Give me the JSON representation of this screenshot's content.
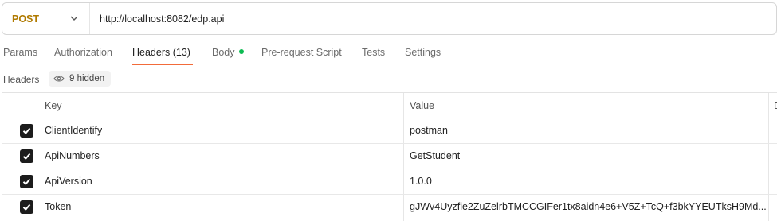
{
  "request": {
    "method": "POST",
    "url": "http://localhost:8082/edp.api"
  },
  "tabs": [
    {
      "label": "Params"
    },
    {
      "label": "Authorization"
    },
    {
      "label": "Headers (13)"
    },
    {
      "label": "Body"
    },
    {
      "label": "Pre-request Script"
    },
    {
      "label": "Tests"
    },
    {
      "label": "Settings"
    }
  ],
  "active_tab": "Headers (13)",
  "headers_section": {
    "label": "Headers",
    "hidden_text": "9 hidden"
  },
  "table": {
    "columns": [
      "Key",
      "Value",
      "D"
    ],
    "rows": [
      {
        "key": "ClientIdentify",
        "value": "postman",
        "checked": true
      },
      {
        "key": "ApiNumbers",
        "value": "GetStudent",
        "checked": true
      },
      {
        "key": "ApiVersion",
        "value": "1.0.0",
        "checked": true
      },
      {
        "key": "Token",
        "value": "gJWv4Uyzfie2ZuZelrbTMCCGIFer1tx8aidn4e6+V5Z+TcQ+f3bkYYEUTksH9Md...",
        "checked": true
      }
    ]
  },
  "colors": {
    "method": "#b07a00",
    "accent": "#f26b3a",
    "body_dot": "#0cbb52"
  }
}
